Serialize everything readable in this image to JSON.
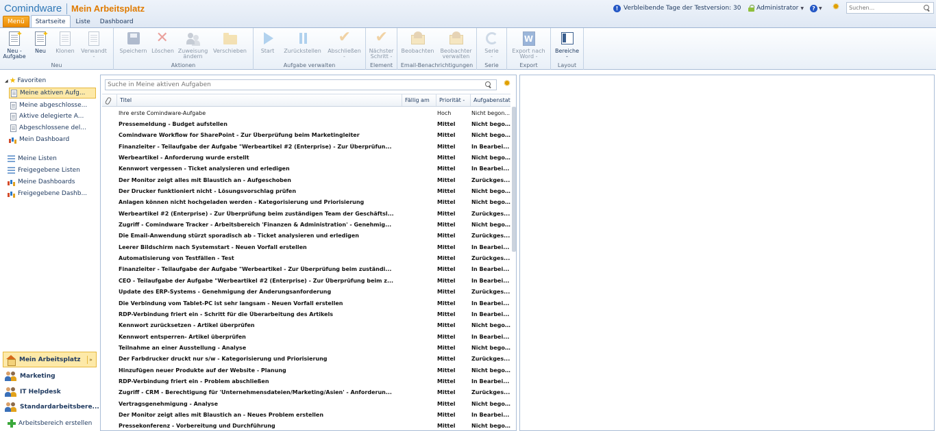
{
  "header": {
    "logo": "Comindware",
    "title": "Mein Arbeitsplatz",
    "trial_text": "Verbleibende Tage der Testversion: 30",
    "user": "Administrator",
    "search_placeholder": "Suchen..."
  },
  "tabs": [
    "Menü",
    "Startseite",
    "Liste",
    "Dashboard"
  ],
  "ribbon": {
    "groups": [
      {
        "name": "Neu",
        "buttons": [
          "Neu -\nAufgabe",
          "Neu",
          "Klonen",
          "Verwandt\n-"
        ]
      },
      {
        "name": "Aktionen",
        "buttons": [
          "Speichern",
          "Löschen",
          "Zuweisung\nändern",
          "Verschieben"
        ]
      },
      {
        "name": "Aufgabe verwalten",
        "buttons": [
          "Start",
          "Zurückstellen",
          "Abschließen\n-"
        ]
      },
      {
        "name": "Element",
        "buttons": [
          "Nächster\nSchritt -"
        ]
      },
      {
        "name": "Email-Benachrichtigungen",
        "buttons": [
          "Beobachten",
          "Beobachter\nverwalten"
        ]
      },
      {
        "name": "Serie",
        "buttons": [
          "Serie\n-"
        ]
      },
      {
        "name": "Export",
        "buttons": [
          "Export nach\nWord -"
        ]
      },
      {
        "name": "Layout",
        "buttons": [
          "Bereiche\n-"
        ]
      }
    ]
  },
  "sidebar": {
    "favorites_label": "Favoriten",
    "favorites": [
      "Meine aktiven Aufg...",
      "Meine abgeschlosse...",
      "Aktive delegierte A...",
      "Abgeschlossene del...",
      "Mein Dashboard"
    ],
    "lists": [
      "Meine Listen",
      "Freigegebene Listen",
      "Meine Dashboards",
      "Freigegebene Dashb..."
    ],
    "workspaces": [
      "Mein Arbeitsplatz",
      "Marketing",
      "IT Helpdesk",
      "Standardarbeitsbere..."
    ],
    "create_workspace": "Arbeitsbereich erstellen"
  },
  "list": {
    "search_prefix": "Suche in ",
    "search_target": "Meine aktiven Aufgaben",
    "columns": [
      "Titel",
      "Fällig am",
      "Priorität -",
      "Aufgabenstat..."
    ],
    "rows": [
      {
        "title": "Ihre erste Comindware-Aufgabe",
        "due": "",
        "priority": "Hoch",
        "status": "Nicht begon...",
        "bold": false
      },
      {
        "title": "Pressemeldung - Budget aufstellen",
        "due": "",
        "priority": "Mittel",
        "status": "Nicht bego...",
        "bold": true
      },
      {
        "title": "Comindware Workflow for SharePoint - Zur Überprüfung beim Marketingleiter",
        "due": "",
        "priority": "Mittel",
        "status": "Nicht bego...",
        "bold": true
      },
      {
        "title": "Finanzleiter - Teilaufgabe der Aufgabe \"Werbeartikel #2 (Enterprise) - Zur Überprüfun...",
        "due": "",
        "priority": "Mittel",
        "status": "In Bearbei...",
        "bold": true
      },
      {
        "title": "Werbeartikel - Anforderung wurde erstellt",
        "due": "",
        "priority": "Mittel",
        "status": "Nicht bego...",
        "bold": true
      },
      {
        "title": "Kennwort vergessen - Ticket analysieren und erledigen",
        "due": "",
        "priority": "Mittel",
        "status": "In Bearbei...",
        "bold": true
      },
      {
        "title": "Der Monitor zeigt alles mit Blaustich an - Aufgeschoben",
        "due": "",
        "priority": "Mittel",
        "status": "Zurückges...",
        "bold": true
      },
      {
        "title": "Der Drucker funktioniert nicht - Lösungsvorschlag prüfen",
        "due": "",
        "priority": "Mittel",
        "status": "Nicht bego...",
        "bold": true
      },
      {
        "title": "Anlagen können nicht hochgeladen werden - Kategorisierung und Priorisierung",
        "due": "",
        "priority": "Mittel",
        "status": "Nicht bego...",
        "bold": true
      },
      {
        "title": "Werbeartikel #2 (Enterprise) - Zur Überprüfung beim zuständigen Team der Geschäftsl...",
        "due": "",
        "priority": "Mittel",
        "status": "Zurückges...",
        "bold": true
      },
      {
        "title": "Zugriff - Comindware Tracker - Arbeitsbereich 'Finanzen & Administration' - Genehmig...",
        "due": "",
        "priority": "Mittel",
        "status": "Nicht bego...",
        "bold": true
      },
      {
        "title": "Die Email-Anwendung stürzt sporadisch ab - Ticket analysieren und erledigen",
        "due": "",
        "priority": "Mittel",
        "status": "Zurückges...",
        "bold": true
      },
      {
        "title": "Leerer Bildschirm nach Systemstart - Neuen Vorfall erstellen",
        "due": "",
        "priority": "Mittel",
        "status": "In Bearbei...",
        "bold": true
      },
      {
        "title": "Automatisierung von Testfällen - Test",
        "due": "",
        "priority": "Mittel",
        "status": "Zurückges...",
        "bold": true
      },
      {
        "title": "Finanzleiter - Teilaufgabe der Aufgabe \"Werbeartikel - Zur Überprüfung beim zuständi...",
        "due": "",
        "priority": "Mittel",
        "status": "In Bearbei...",
        "bold": true
      },
      {
        "title": "CEO - Teilaufgabe der Aufgabe \"Werbeartikel #2 (Enterprise) - Zur Überprüfung beim z...",
        "due": "",
        "priority": "Mittel",
        "status": "In Bearbei...",
        "bold": true
      },
      {
        "title": "Update des ERP-Systems - Genehmigung der Änderungsanforderung",
        "due": "",
        "priority": "Mittel",
        "status": "Zurückges...",
        "bold": true
      },
      {
        "title": "Die Verbindung vom Tablet-PC ist sehr langsam - Neuen Vorfall erstellen",
        "due": "",
        "priority": "Mittel",
        "status": "In Bearbei...",
        "bold": true
      },
      {
        "title": "RDP-Verbindung friert ein - Schritt für die Überarbeitung des Artikels",
        "due": "",
        "priority": "Mittel",
        "status": "In Bearbei...",
        "bold": true
      },
      {
        "title": "Kennwort zurücksetzen - Artikel überprüfen",
        "due": "",
        "priority": "Mittel",
        "status": "Nicht bego...",
        "bold": true
      },
      {
        "title": "Kennwort entsperren- Artikel überprüfen",
        "due": "",
        "priority": "Mittel",
        "status": "In Bearbei...",
        "bold": true
      },
      {
        "title": "Teilnahme an einer Ausstellung - Analyse",
        "due": "",
        "priority": "Mittel",
        "status": "Nicht bego...",
        "bold": true
      },
      {
        "title": "Der Farbdrucker druckt nur s/w - Kategorisierung und Priorisierung",
        "due": "",
        "priority": "Mittel",
        "status": "Zurückges...",
        "bold": true
      },
      {
        "title": "Hinzufügen neuer Produkte auf der Website - Planung",
        "due": "",
        "priority": "Mittel",
        "status": "Nicht bego...",
        "bold": true
      },
      {
        "title": "RDP-Verbindung friert ein - Problem abschließen",
        "due": "",
        "priority": "Mittel",
        "status": "In Bearbei...",
        "bold": true
      },
      {
        "title": "Zugriff - CRM - Berechtigung für 'Unternehmensdateien/Marketing/Asien' - Anforderun...",
        "due": "",
        "priority": "Mittel",
        "status": "Zurückges...",
        "bold": true
      },
      {
        "title": "Vertragsgenehmigung - Analyse",
        "due": "",
        "priority": "Mittel",
        "status": "Nicht bego...",
        "bold": true
      },
      {
        "title": "Der Monitor zeigt alles mit Blaustich an - Neues Problem erstellen",
        "due": "",
        "priority": "Mittel",
        "status": "In Bearbei...",
        "bold": true
      },
      {
        "title": "Pressekonferenz - Vorbereitung und Durchführung",
        "due": "",
        "priority": "Mittel",
        "status": "Nicht bego...",
        "bold": true
      }
    ]
  }
}
